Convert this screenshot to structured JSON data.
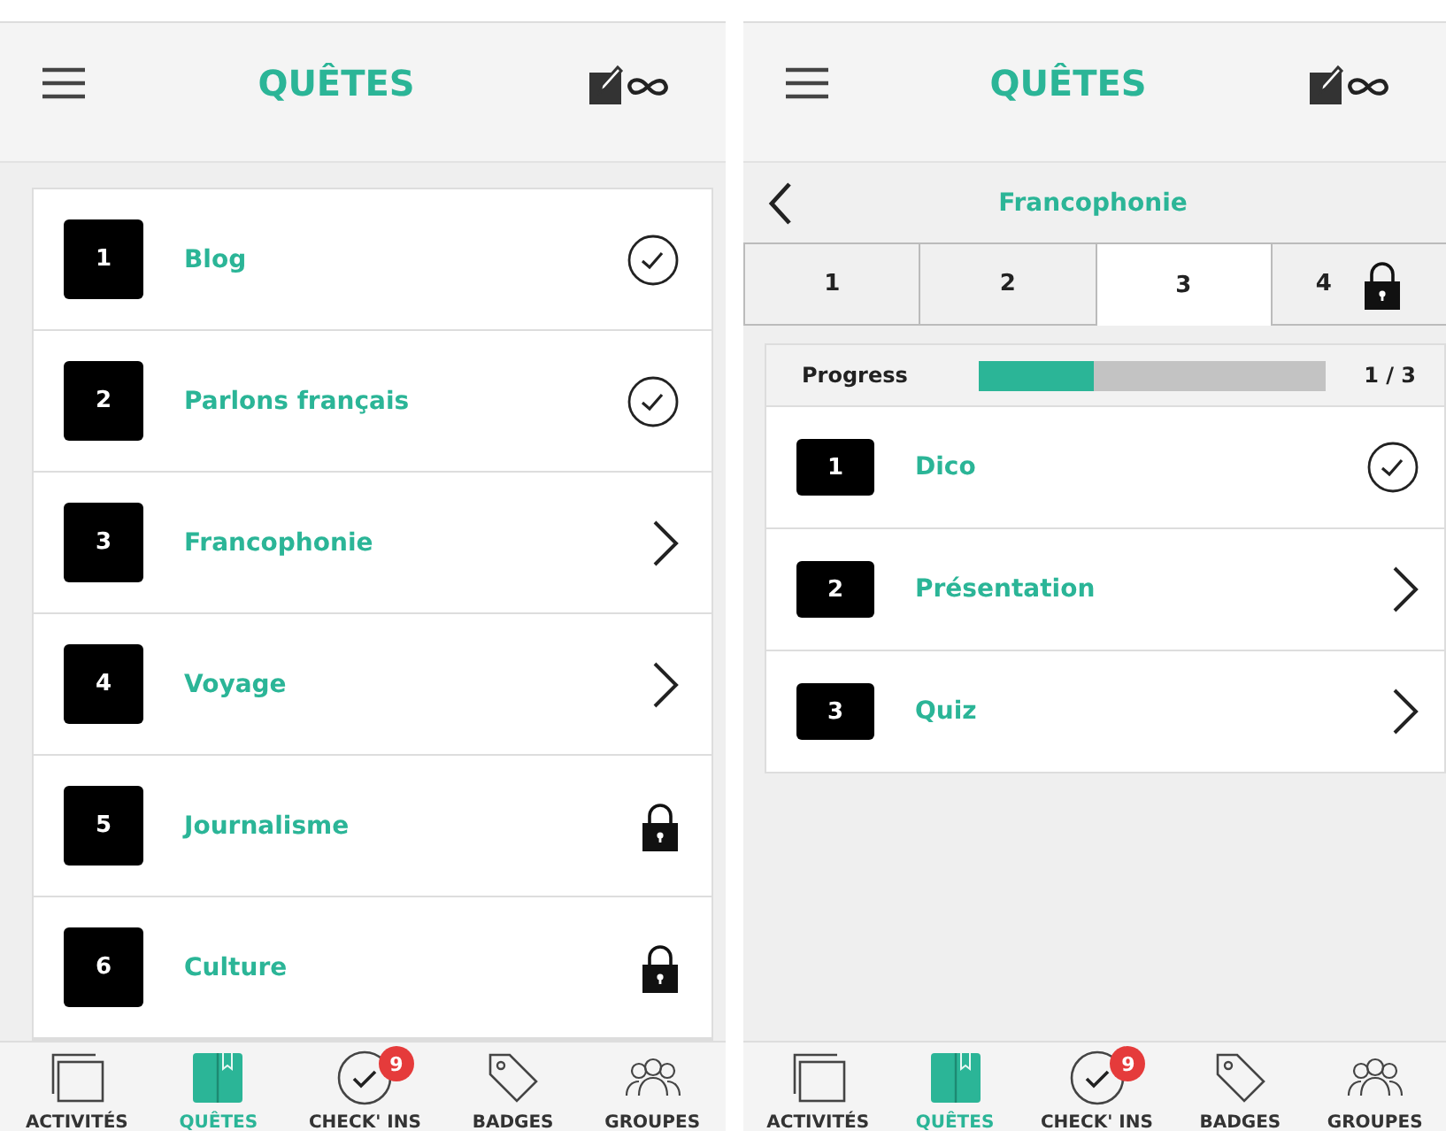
{
  "screens": [
    {
      "header": {
        "title": "QUÊTES"
      },
      "quests": [
        {
          "number": "1",
          "name": "Blog",
          "kind": "done"
        },
        {
          "number": "2",
          "name": "Parlons français",
          "kind": "done"
        },
        {
          "number": "3",
          "name": "Francophonie",
          "kind": "open"
        },
        {
          "number": "4",
          "name": "Voyage",
          "kind": "open"
        },
        {
          "number": "5",
          "name": "Journalisme",
          "kind": "locked"
        },
        {
          "number": "6",
          "name": "Culture",
          "kind": "locked"
        }
      ],
      "nav": [
        {
          "label": "ACTIVITÉS",
          "kind": "activities",
          "selected": false
        },
        {
          "label": "QUÊTES",
          "kind": "quests",
          "selected": true
        },
        {
          "label": "CHECK' INS",
          "kind": "checkins",
          "selected": false,
          "badge": "9"
        },
        {
          "label": "BADGES",
          "kind": "badges",
          "selected": false
        },
        {
          "label": "GROUPES",
          "kind": "groups",
          "selected": false
        }
      ]
    },
    {
      "header": {
        "title": "QUÊTES"
      },
      "detail": {
        "title": "Francophonie",
        "tabs": [
          {
            "label": "1",
            "selected": false,
            "locked": false
          },
          {
            "label": "2",
            "selected": false,
            "locked": false
          },
          {
            "label": "3",
            "selected": true,
            "locked": false
          },
          {
            "label": "4",
            "selected": false,
            "locked": true
          }
        ],
        "progress": {
          "label": "Progress",
          "level": 0.33,
          "reading": "1 / 3"
        },
        "steps": [
          {
            "number": "1",
            "name": "Dico",
            "kind": "done"
          },
          {
            "number": "2",
            "name": "Présentation",
            "kind": "open"
          },
          {
            "number": "3",
            "name": "Quiz",
            "kind": "open"
          }
        ]
      },
      "nav": [
        {
          "label": "ACTIVITÉS",
          "kind": "activities",
          "selected": false
        },
        {
          "label": "QUÊTES",
          "kind": "quests",
          "selected": true
        },
        {
          "label": "CHECK' INS",
          "kind": "checkins",
          "selected": false,
          "badge": "9"
        },
        {
          "label": "BADGES",
          "kind": "badges",
          "selected": false
        },
        {
          "label": "GROUPES",
          "kind": "groups",
          "selected": false
        }
      ]
    }
  ]
}
